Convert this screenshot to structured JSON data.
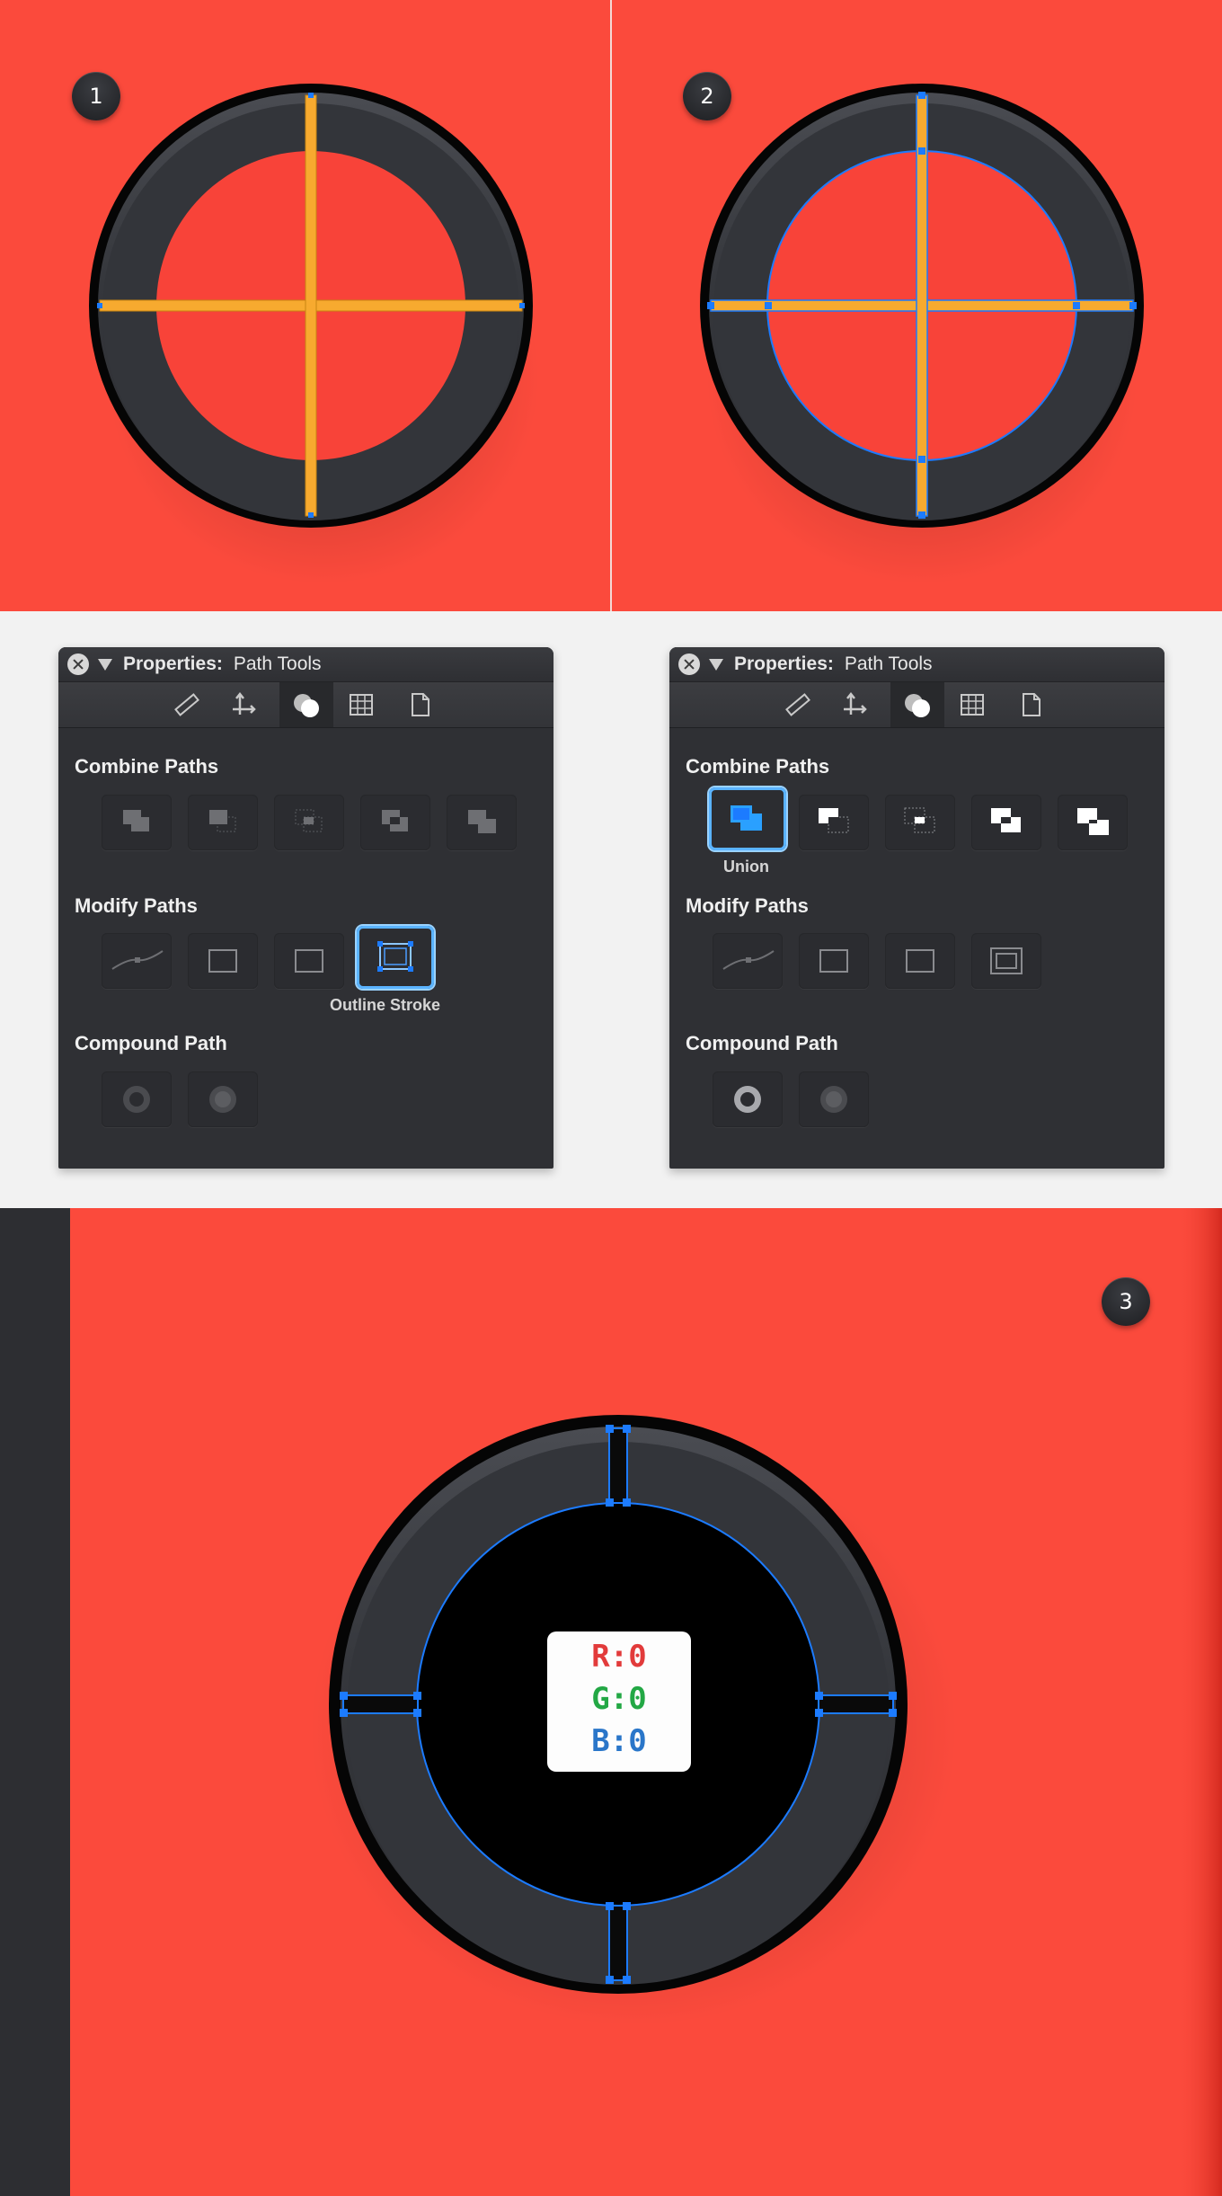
{
  "steps": {
    "one": "1",
    "two": "2",
    "three": "3"
  },
  "properties_panels": [
    {
      "title_label": "Properties:",
      "title_value": "Path Tools",
      "sections": {
        "combine": "Combine Paths",
        "modify": "Modify Paths",
        "compound": "Compound Path"
      },
      "selected_caption": "Outline Stroke"
    },
    {
      "title_label": "Properties:",
      "title_value": "Path Tools",
      "sections": {
        "combine": "Combine Paths",
        "modify": "Modify Paths",
        "compound": "Compound Path"
      },
      "selected_caption": "Union"
    }
  ],
  "rgb_swatch": {
    "r": "R:0",
    "g": "G:0",
    "b": "B:0"
  },
  "colors": {
    "canvas_background": "#fb4a3c",
    "ring": "#36373c",
    "guide_stroke": "#f7aa2f",
    "selection": "#1c7bff",
    "panel_bg": "#2f3034"
  },
  "icons": {
    "toolbar": [
      "ruler-icon",
      "move-arrows-icon",
      "shapes-circles-icon",
      "grid-icon",
      "document-icon"
    ],
    "combine": [
      "union-icon",
      "subtract-icon",
      "intersect-icon",
      "exclude-icon",
      "divide-icon"
    ],
    "modify": [
      "smooth-path-icon",
      "flatten-icon",
      "reverse-icon",
      "outline-stroke-icon"
    ],
    "compound": [
      "make-compound-icon",
      "release-compound-icon"
    ]
  }
}
